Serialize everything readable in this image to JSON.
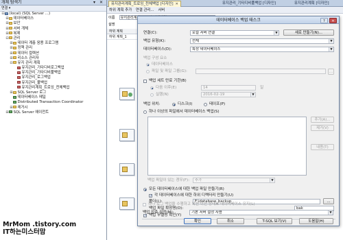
{
  "explorer": {
    "title": "개체 탐색기",
    "header_controls": "▾ ✕",
    "toolbar": "연결 ▾",
    "rows": [
      {
        "label": "(local) (SQL Server ...) ",
        "expander": "⊟",
        "icon": "server"
      },
      {
        "label": "데이터베이스",
        "expander": "⊞",
        "icon": "folder"
      },
      {
        "label": "보안",
        "expander": "⊞",
        "icon": "folder"
      },
      {
        "label": "서버 개체",
        "expander": "⊞",
        "icon": "folder"
      },
      {
        "label": "복제",
        "expander": "⊞",
        "icon": "folder"
      },
      {
        "label": "관리",
        "expander": "⊟",
        "icon": "folder"
      },
      {
        "label": "데이터 계층 응용 프로그램",
        "expander": "⊞",
        "icon": "folder"
      },
      {
        "label": "정책 관리",
        "expander": "⊞",
        "icon": "folder"
      },
      {
        "label": "데이터 컬렉션",
        "expander": "⊞",
        "icon": "folder"
      },
      {
        "label": "리소스 관리자",
        "expander": "⊞",
        "icon": "folder"
      },
      {
        "label": "유지 관리 계획",
        "expander": "⊟",
        "icon": "folder"
      },
      {
        "label": "유지관리_기타디비로그백업",
        "expander": "",
        "icon": "job"
      },
      {
        "label": "유지관리_기타디비풀백업",
        "expander": "",
        "icon": "job"
      },
      {
        "label": "유지관리_로그백업",
        "expander": "",
        "icon": "job"
      },
      {
        "label": "유지관리_풀백업",
        "expander": "",
        "icon": "job"
      },
      {
        "label": "유지관리계획_트로잉_전체백업",
        "expander": "",
        "icon": "job"
      },
      {
        "label": "SQL Server 로그",
        "expander": "⊞",
        "icon": "folder"
      },
      {
        "label": "데이터베이스 메일",
        "expander": "",
        "icon": "svc"
      },
      {
        "label": "Distributed Transaction Coordinator",
        "expander": "",
        "icon": "svc"
      },
      {
        "label": "레거시",
        "expander": "⊞",
        "icon": "folder"
      },
      {
        "label": "SQL Server 에이전트",
        "expander": "⊞",
        "icon": "svc"
      }
    ]
  },
  "watermark": {
    "line1": "MrMom .tistory.com",
    "line2": "IT하는미스터맘"
  },
  "tabs": [
    {
      "label": "유지관리계획_트로잉_전체백업 [디자인]",
      "active": true
    },
    {
      "label": "유지관리_기타디비풀백업 [디자인]",
      "active": false
    },
    {
      "label": "유지관리계획 [디자인]",
      "active": false
    }
  ],
  "designer_toolbar": {
    "add_subplan": "하위 계획 추가",
    "connections": "연결 관리...",
    "server": "서버"
  },
  "designer": {
    "name_label": "이름",
    "name_value": "유지관리계획_트로잉_전체백업",
    "desc_label": "설명",
    "subplan_header": "하위 계획",
    "subplan_value": "하위 계획_1"
  },
  "dialog": {
    "title": "데이터베이스 백업 태스크",
    "help": "?",
    "close": "✕",
    "connection_label": "연결(C):",
    "connection_value": "로컬 서버 연결",
    "new_button": "새로 만들기(N)...",
    "backup_type_label": "백업 유형(K):",
    "backup_type_value": "전체",
    "database_label": "데이터베이스(D):",
    "database_value": "특정 데이터베이스",
    "component_label": "백업 구성 요소",
    "component_db": "데이터베이스",
    "component_files": "파일 및 파일 그룹(G):",
    "backup_set_expire": "백업 세트 만료 기한(B)",
    "after_label": "다음 이후(E)",
    "after_value": "14",
    "after_unit": "일",
    "on_label": "실행(N)",
    "on_value": "2016-02-19",
    "backup_to_label": "백업 위치:",
    "disk_label": "디스크(I)",
    "tape_label": "테이프(P)",
    "span_label": "하나 이상의 파일에서 데이터베이스 백업(S)",
    "add_button": "추가(A)...",
    "remove_button": "제거(V)",
    "contents_button": "내용(T)",
    "existing_label": "백업 파일이 있는 경우(F):",
    "existing_value": "추가",
    "per_db_label": "모든 데이터베이스에 대한 백업 파일 만들기(R)",
    "subdir_label": "각 데이터베이스에 대한 하위 디렉터리 만들기(U)",
    "folder_label": "폴더(L):",
    "folder_value": "F:\\database_backup",
    "folder_browse": "...",
    "ext_label": "백업 파일 확장명(O):",
    "ext_value": "bak",
    "verify_label": "백업 무결성 확인(Y)",
    "copy_only_label": "하나 로그 백업을 수행하고 복원 이전 상태로 데이터베이스 유지(L)",
    "compression_label": "백업 압축 설정(M):",
    "compression_value": "기본 서버 설정 사용",
    "ok_button": "확인",
    "cancel_button": "취소",
    "tsql_button": "T-SQL 보기(V)",
    "help_button": "도움말(H)"
  }
}
